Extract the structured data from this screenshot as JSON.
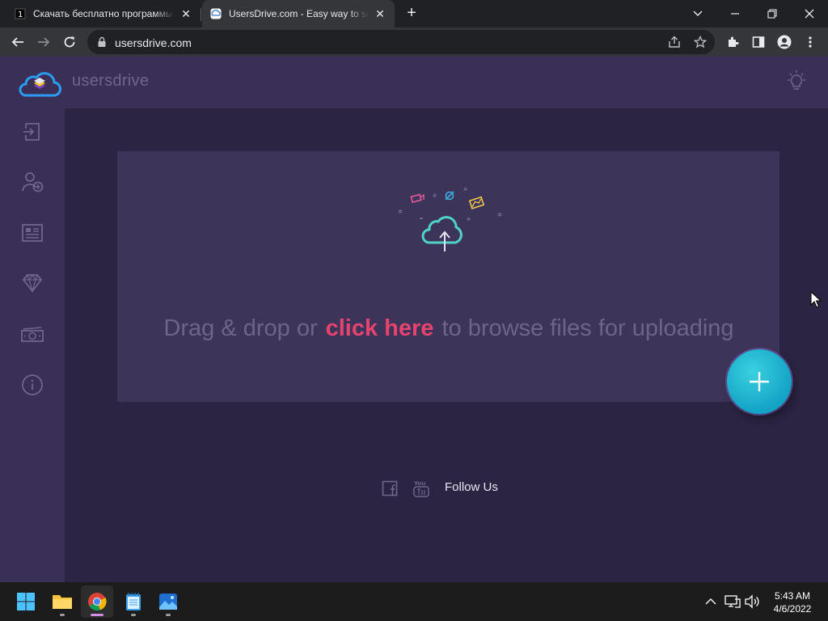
{
  "browser": {
    "tabs": [
      {
        "title": "Скачать бесплатно программы",
        "favicon": "dark-square-icon",
        "active": false
      },
      {
        "title": "UsersDrive.com - Easy way to share",
        "favicon": "usersdrive-icon",
        "active": true
      }
    ],
    "new_tab_label": "+",
    "url": "usersdrive.com"
  },
  "site": {
    "brand_name": "usersdrive",
    "sidebar_icons": [
      "login-icon",
      "add-user-icon",
      "news-icon",
      "diamond-icon",
      "money-icon",
      "info-icon"
    ],
    "upload": {
      "text_before": "Drag & drop or",
      "link_text": "click here",
      "text_after": "to browse files for uploading"
    },
    "follow_label": "Follow Us",
    "colors": {
      "background": "#2b2443",
      "panel": "#3a2f57",
      "dropzone": "#3d3459",
      "accent_link": "#e6436f",
      "fab": "#13a3c6"
    }
  },
  "taskbar": {
    "apps": [
      "start-icon",
      "file-explorer-icon",
      "chrome-icon",
      "notepad-icon",
      "photos-icon"
    ],
    "time": "5:43 AM",
    "date": "4/6/2022"
  }
}
